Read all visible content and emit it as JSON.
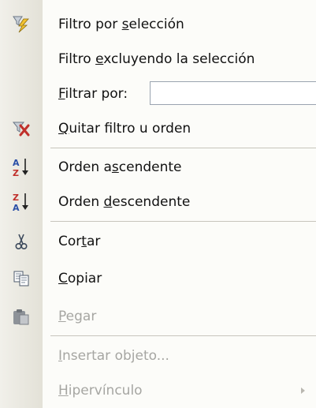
{
  "menu": {
    "items": [
      {
        "pre": "Filtro por ",
        "key": "s",
        "post": "elección",
        "icon": "filter-by-selection-icon"
      },
      {
        "pre": "Filtro ",
        "key": "e",
        "post": "xcluyendo la selección"
      },
      {
        "pre": "",
        "key": "F",
        "post": "iltrar por:",
        "input_value": ""
      },
      {
        "pre": "",
        "key": "Q",
        "post": "uitar filtro u orden",
        "icon": "remove-filter-icon"
      },
      {
        "pre": "Orden a",
        "key": "s",
        "post": "cendente",
        "icon": "sort-ascending-icon"
      },
      {
        "pre": "Orden ",
        "key": "d",
        "post": "escendente",
        "icon": "sort-descending-icon"
      },
      {
        "pre": "Cor",
        "key": "t",
        "post": "ar",
        "icon": "scissors-icon"
      },
      {
        "pre": "",
        "key": "C",
        "post": "opiar",
        "icon": "copy-icon"
      },
      {
        "pre": "",
        "key": "P",
        "post": "egar",
        "icon": "paste-icon",
        "disabled": true
      },
      {
        "pre": "",
        "key": "I",
        "post": "nsertar objeto...",
        "disabled": true
      },
      {
        "pre": "",
        "key": "H",
        "post": "ipervínculo",
        "disabled": true,
        "submenu": true
      }
    ]
  },
  "colors": {
    "menu_background": "#fcfcf9",
    "gutter": "#e8e6dd",
    "disabled_text": "#a6a6a2",
    "icon_red": "#c0302b",
    "icon_blue": "#2a4fa7"
  }
}
